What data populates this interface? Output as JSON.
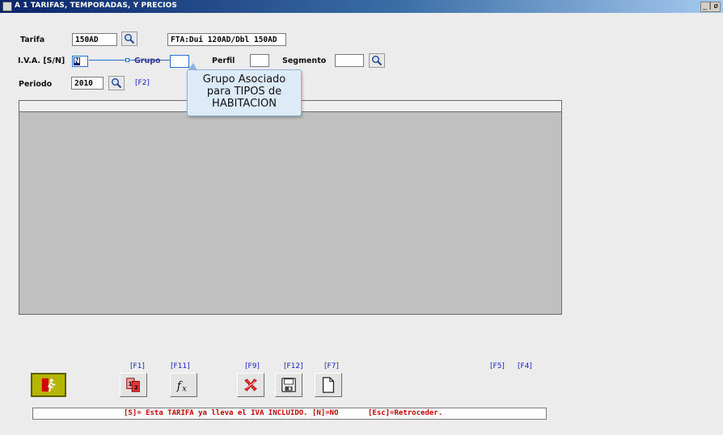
{
  "window": {
    "title": "A 1  TARIFAS, TEMPORADAS, Y PRECIOS",
    "controls": "_ | ø"
  },
  "form": {
    "tarifa": {
      "label": "Tarifa",
      "value": "150AD",
      "description": "FTA:Dui 120AD/Dbl 150AD"
    },
    "iva": {
      "label": "I.V.A. [S/N]",
      "value": "N"
    },
    "grupo": {
      "label": "Grupo",
      "value": ""
    },
    "perfil": {
      "label": "Perfil",
      "value": ""
    },
    "segmento": {
      "label": "Segmento",
      "value": ""
    },
    "periodo": {
      "label": "Periodo",
      "value": "2010",
      "fkey": "[F2]"
    }
  },
  "tooltip": {
    "lines": [
      "Grupo Asociado",
      "para TIPOS de",
      "HABITACION"
    ]
  },
  "toolbar": {
    "fkeys": {
      "f1": "[F1]",
      "f11": "[F11]",
      "f9": "[F9]",
      "f12": "[F12]",
      "f7": "[F7]",
      "f5": "[F5]",
      "f4": "[F4]"
    },
    "icons": [
      "exit-icon",
      "numbering-icon",
      "formula-icon",
      "delete-icon",
      "save-icon",
      "new-document-icon"
    ]
  },
  "status": {
    "message": "[S]= Esta TARIFA ya lleva el IVA INCLUIDO.  [N]=NO",
    "escape": "[Esc]=Retroceder."
  },
  "colors": {
    "fkey": "#1a24c0",
    "status_text": "#c00000",
    "grid": "#c0c0c0",
    "tooltip": "#ddeaf7"
  }
}
